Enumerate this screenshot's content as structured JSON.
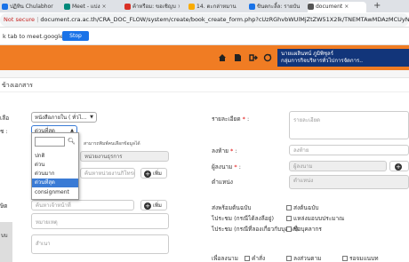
{
  "browser": {
    "tabs": [
      {
        "label": "ปฏิทิน Chulabhor",
        "color": "#1a73e8"
      },
      {
        "label": "Meet - แบ่ง",
        "color": "#00897b"
      },
      {
        "label": "ค้าหรือม: ขอเชิญบ",
        "color": "#d93025"
      },
      {
        "label": "14. ตะกล่าหมาน",
        "color": "#f9ab00"
      },
      {
        "label": "ขินตกะลี้ล: รายบัน",
        "color": "#1a73e8"
      },
      {
        "label": "document",
        "color": "#555555"
      }
    ],
    "new_tab": "+",
    "not_secure": "Not secure",
    "url": "document.cra.ac.th/CRA_DOC_FLOW/system/create/book_create_form.php?cUzRGhvbWUlMjZtZW51X2lk/TNEMTAwMDAzMCUyNm11",
    "share_text": "k tab to meet.google.com",
    "stop_label": "Stop"
  },
  "header": {
    "accent": "#f07c23",
    "user_line1": "นายแผลินทน์ ภูมิพิชุลร์",
    "user_line2": "กลุ่มการกิจบริหารทั่วไปการจัดการ..",
    "icons": [
      "home-icon",
      "document-icon",
      "signout-icon",
      "refresh-icon"
    ]
  },
  "page": {
    "title": "ข้างเอกสาร"
  },
  "form": {
    "left": {
      "type_label": "เลือ",
      "type_value": "หนังสือภายใน ( ทั่วไ...",
      "priority_label": "ช :",
      "priority_value": "ด่วนที่สุด",
      "priority_hint": "สามารถพิมพ์คนเลือกข้อมูลได้",
      "from_value": "หน่วยงานธุรการ",
      "from_dept_value": "ค้นหาหน่วยงานกิโทรเอกสาร",
      "add_label": "เพิ่ม",
      "recipient_label": "ษิต",
      "recipient_value": "ค้นหาเจ้าหน้าที่",
      "note_placeholder": "หมายเหตุ",
      "note2_placeholder": "สำเนา"
    },
    "dropdown": {
      "options": [
        "ปกติ",
        "ด่วน",
        "ด่วนมาก",
        "ด่วนที่สุด",
        "consignment"
      ],
      "selected": "ด่วนที่สุด"
    },
    "right": {
      "detail_label": "รายละเอียด",
      "detail_placeholder": "รายละเอียด",
      "sign_label": "ลงท้าย",
      "sign_value": "ลงท้าย",
      "signer_label": "ผู้ลงนาม",
      "signer_value": "ผู้ลงนาม",
      "position_label": "ตำแหน่ง",
      "position_value": "ตำแหน่ง",
      "send_check_label": "ส่งพร้อมต้นฉบับ",
      "send_check_value": "ส่งต้นฉบับ",
      "sig_label": "ไประชม (กรณีได้ลงลีอยู่)",
      "sig_value": "แหล่งมอบบประมาณ",
      "approve_label": "ไประชม (กรณีที่ลองเกี่ยวกับบุคคล)",
      "approve_value": "ชื่อบุคลากร",
      "line_label": "เพื่อลงนาม",
      "line_options": [
        "คำสั่ง",
        "ลงส่วนตาม",
        "รอจมแนบท"
      ]
    }
  },
  "footer": {
    "left_text": "บบ"
  }
}
